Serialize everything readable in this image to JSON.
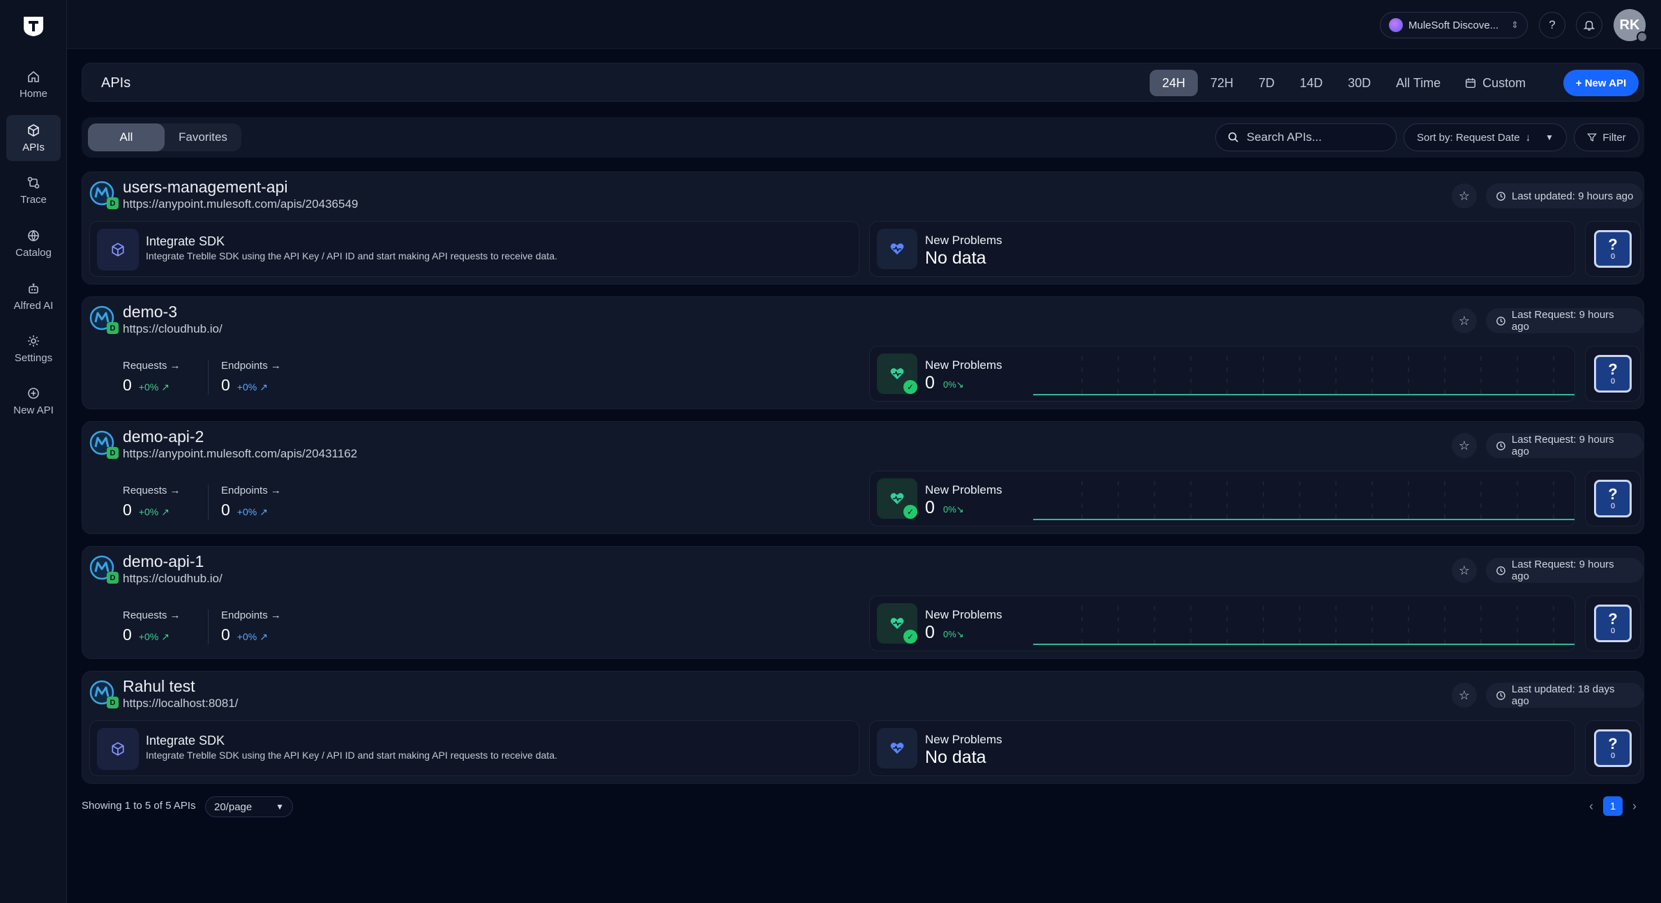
{
  "sidebar": {
    "items": [
      {
        "label": "Home",
        "icon": "home-icon"
      },
      {
        "label": "APIs",
        "icon": "apis-icon",
        "active": true
      },
      {
        "label": "Trace",
        "icon": "trace-icon"
      },
      {
        "label": "Catalog",
        "icon": "catalog-icon"
      },
      {
        "label": "Alfred AI",
        "icon": "robot-icon"
      },
      {
        "label": "Settings",
        "icon": "gear-icon"
      },
      {
        "label": "New API",
        "icon": "plus-circle-icon"
      }
    ]
  },
  "topbar": {
    "org": "MuleSoft Discove...",
    "help": "?",
    "avatar_initials": "RK"
  },
  "header": {
    "title": "APIs",
    "ranges": [
      "24H",
      "72H",
      "7D",
      "14D",
      "30D",
      "All Time"
    ],
    "active_range": "24H",
    "custom_label": "Custom",
    "new_api_label": "+ New API"
  },
  "filters": {
    "tabs": [
      "All",
      "Favorites"
    ],
    "active_tab": "All",
    "search_placeholder": "Search APIs...",
    "sort_label": "Sort by: Request Date",
    "filter_label": "Filter"
  },
  "apis": [
    {
      "name": "users-management-api",
      "url": "https://anypoint.mulesoft.com/apis/20436549",
      "badge": "D",
      "updated": "Last updated: 9 hours ago",
      "mode": "sdk",
      "sdk_title": "Integrate SDK",
      "sdk_desc": "Integrate Treblle SDK using the API Key / API ID and start making API requests to receive data.",
      "problems_label": "New Problems",
      "problems_value": "No data",
      "problems_delta": "",
      "score": "0"
    },
    {
      "name": "demo-3",
      "url": "https://cloudhub.io/",
      "badge": "D",
      "updated": "Last Request: 9 hours ago",
      "mode": "metrics",
      "requests_label": "Requests →",
      "requests_value": "0",
      "requests_delta": "+0% ↗",
      "endpoints_label": "Endpoints →",
      "endpoints_value": "0",
      "endpoints_delta": "+0% ↗",
      "problems_label": "New Problems",
      "problems_value": "0",
      "problems_delta": "0%↘",
      "score": "0"
    },
    {
      "name": "demo-api-2",
      "url": "https://anypoint.mulesoft.com/apis/20431162",
      "badge": "D",
      "updated": "Last Request: 9 hours ago",
      "mode": "metrics",
      "requests_label": "Requests →",
      "requests_value": "0",
      "requests_delta": "+0% ↗",
      "endpoints_label": "Endpoints →",
      "endpoints_value": "0",
      "endpoints_delta": "+0% ↗",
      "problems_label": "New Problems",
      "problems_value": "0",
      "problems_delta": "0%↘",
      "score": "0"
    },
    {
      "name": "demo-api-1",
      "url": "https://cloudhub.io/",
      "badge": "D",
      "updated": "Last Request: 9 hours ago",
      "mode": "metrics",
      "requests_label": "Requests →",
      "requests_value": "0",
      "requests_delta": "+0% ↗",
      "endpoints_label": "Endpoints →",
      "endpoints_value": "0",
      "endpoints_delta": "+0% ↗",
      "problems_label": "New Problems",
      "problems_value": "0",
      "problems_delta": "0%↘",
      "score": "0"
    },
    {
      "name": "Rahul test",
      "url": "https://localhost:8081/",
      "badge": "D",
      "updated": "Last updated: 18 days ago",
      "mode": "sdk",
      "sdk_title": "Integrate SDK",
      "sdk_desc": "Integrate Treblle SDK using the API Key / API ID and start making API requests to receive data.",
      "problems_label": "New Problems",
      "problems_value": "No data",
      "problems_delta": "",
      "score": "0"
    }
  ],
  "footer": {
    "showing": "Showing 1 to 5 of 5 APIs",
    "page_size": "20/page",
    "current_page": "1"
  },
  "colors": {
    "accent": "#1766ff",
    "positive": "#3fd08f",
    "background": "#050a1a"
  }
}
